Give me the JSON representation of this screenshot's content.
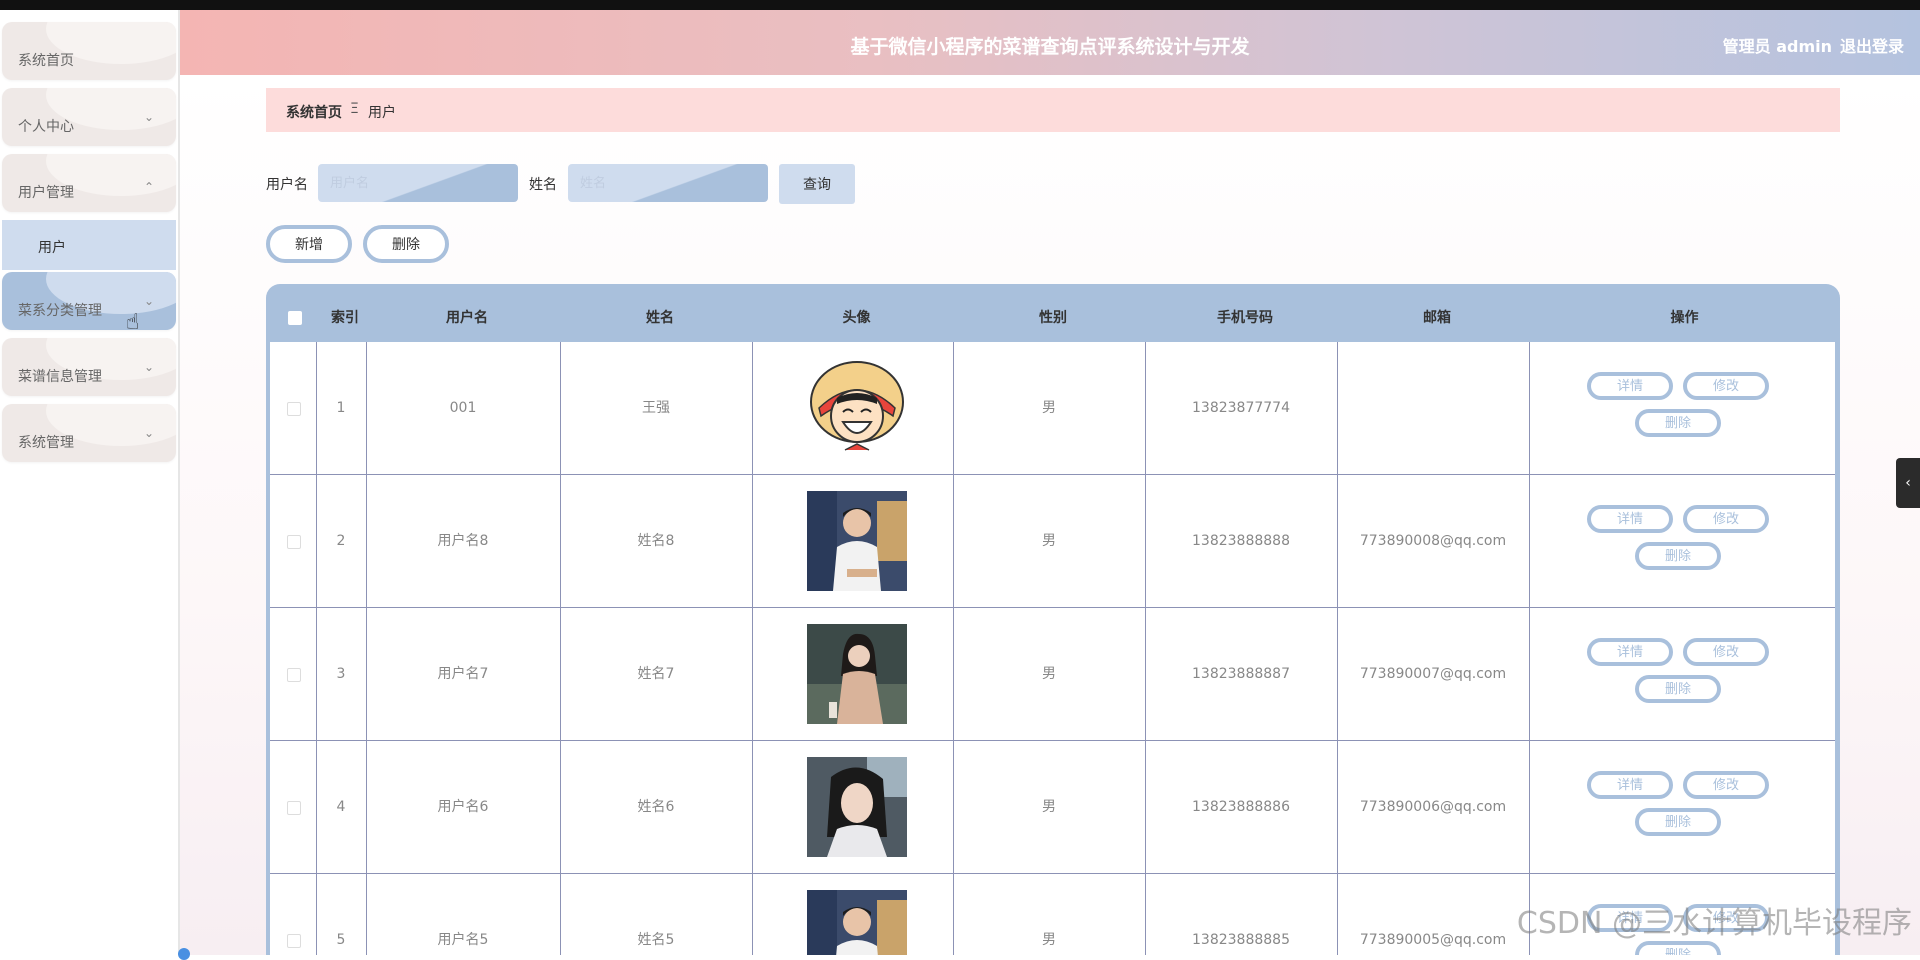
{
  "header": {
    "title": "基于微信小程序的菜谱查询点评系统设计与开发",
    "user": "管理员 admin",
    "logout": "退出登录"
  },
  "sidebar": {
    "items": [
      {
        "label": "系统首页",
        "has_chevron": false
      },
      {
        "label": "个人中心",
        "has_chevron": true
      },
      {
        "label": "用户管理",
        "has_chevron": true,
        "expanded": true
      },
      {
        "label": "菜系分类管理",
        "has_chevron": true,
        "hovered": true
      },
      {
        "label": "菜谱信息管理",
        "has_chevron": true
      },
      {
        "label": "系统管理",
        "has_chevron": true
      }
    ],
    "submenu": "用户",
    "chevron_down": "⌄",
    "chevron_up": "⌃"
  },
  "breadcrumb": {
    "home": "系统首页",
    "separator": "Ξ",
    "current": "用户"
  },
  "search": {
    "username_label": "用户名",
    "username_placeholder": "用户名",
    "name_label": "姓名",
    "name_placeholder": "姓名",
    "query_button": "查询"
  },
  "actions": {
    "add": "新增",
    "delete": "删除"
  },
  "table": {
    "headers": [
      "",
      "索引",
      "用户名",
      "姓名",
      "头像",
      "性别",
      "手机号码",
      "邮箱",
      "操作"
    ],
    "rows": [
      {
        "index": "1",
        "username": "001",
        "name": "王强",
        "gender": "男",
        "phone": "13823877774",
        "email": "",
        "avatar": "cartoon"
      },
      {
        "index": "2",
        "username": "用户名8",
        "name": "姓名8",
        "gender": "男",
        "phone": "13823888888",
        "email": "773890008@qq.com",
        "avatar": "photo-a"
      },
      {
        "index": "3",
        "username": "用户名7",
        "name": "姓名7",
        "gender": "男",
        "phone": "13823888887",
        "email": "773890007@qq.com",
        "avatar": "photo-b"
      },
      {
        "index": "4",
        "username": "用户名6",
        "name": "姓名6",
        "gender": "男",
        "phone": "13823888886",
        "email": "773890006@qq.com",
        "avatar": "photo-c"
      },
      {
        "index": "5",
        "username": "用户名5",
        "name": "姓名5",
        "gender": "男",
        "phone": "13823888885",
        "email": "773890005@qq.com",
        "avatar": "photo-a"
      }
    ],
    "op_detail": "详情",
    "op_edit": "修改",
    "op_delete": "删除"
  },
  "side_tab": "‹",
  "watermark": "CSDN @三水计算机毕设程序",
  "colors": {
    "accent_blue": "#a9c0dc",
    "light_blue": "#cfdcee",
    "breadcrumb_pink": "#fddcdb"
  }
}
